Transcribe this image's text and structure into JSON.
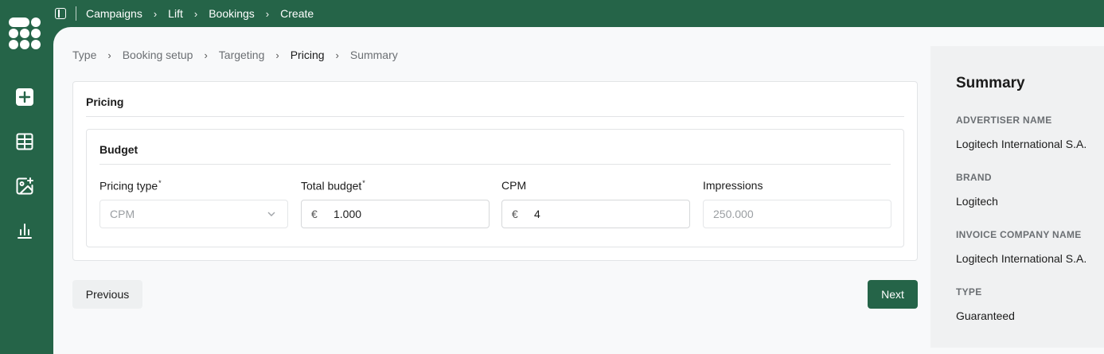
{
  "topbar": {
    "crumbs": [
      "Campaigns",
      "Lift",
      "Bookings",
      "Create"
    ]
  },
  "sidebar": {
    "items": [
      {
        "icon": "plus-square-icon"
      },
      {
        "icon": "table-icon"
      },
      {
        "icon": "image-add-icon"
      },
      {
        "icon": "bar-chart-icon"
      }
    ]
  },
  "steps": [
    "Type",
    "Booking setup",
    "Targeting",
    "Pricing",
    "Summary"
  ],
  "active_step": "Pricing",
  "pricing": {
    "title": "Pricing",
    "budget": {
      "title": "Budget",
      "pricing_type": {
        "label": "Pricing type",
        "value": "CPM"
      },
      "total_budget": {
        "label": "Total budget",
        "currency": "€",
        "value": "1.000"
      },
      "cpm": {
        "label": "CPM",
        "currency": "€",
        "value": "4"
      },
      "impressions": {
        "label": "Impressions",
        "placeholder": "250.000"
      }
    }
  },
  "buttons": {
    "previous": "Previous",
    "next": "Next"
  },
  "summary": {
    "title": "Summary",
    "items": [
      {
        "label": "Advertiser name",
        "value": "Logitech International S.A."
      },
      {
        "label": "Brand",
        "value": "Logitech"
      },
      {
        "label": "Invoice company name",
        "value": "Logitech International S.A."
      },
      {
        "label": "Type",
        "value": "Guaranteed"
      }
    ]
  },
  "colors": {
    "brand": "#256448",
    "background": "#f8f9fa"
  }
}
